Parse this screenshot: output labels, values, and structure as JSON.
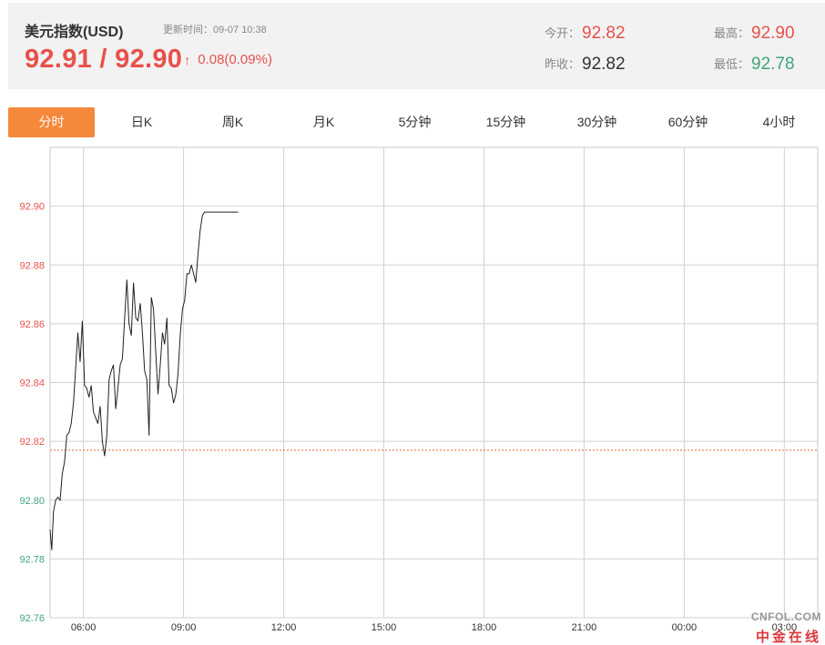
{
  "header": {
    "title": "美元指数(USD)",
    "update_label": "更新时间：",
    "update_time": "09-07 10:38",
    "price_text": "92.91 / 92.90",
    "arrow": "↑",
    "change_text": "0.08(0.09%)",
    "open_label": "今开：",
    "open_value": "92.82",
    "prev_close_label": "昨收：",
    "prev_close_value": "92.82",
    "high_label": "最高：",
    "high_value": "92.90",
    "low_label": "最低：",
    "low_value": "92.78"
  },
  "tabs": [
    {
      "label": "分时",
      "active": true
    },
    {
      "label": "日K",
      "active": false
    },
    {
      "label": "周K",
      "active": false
    },
    {
      "label": "月K",
      "active": false
    },
    {
      "label": "5分钟",
      "active": false
    },
    {
      "label": "15分钟",
      "active": false
    },
    {
      "label": "30分钟",
      "active": false
    },
    {
      "label": "60分钟",
      "active": false
    },
    {
      "label": "4小时",
      "active": false
    }
  ],
  "colors": {
    "up": "#e8514a",
    "down": "#3fa67a",
    "accent": "#f4883b",
    "line": "#222222",
    "reference": "#e07030"
  },
  "logo": {
    "top_text": "CNFOL.COM",
    "bottom_text": "中金在线"
  },
  "chart_data": {
    "type": "line",
    "title": "",
    "xlabel": "",
    "ylabel": "",
    "x_ticks": [
      "06:00",
      "09:00",
      "12:00",
      "15:00",
      "18:00",
      "21:00",
      "00:00",
      "03:00"
    ],
    "x_range": [
      "05:00",
      "04:00+1"
    ],
    "y_ticks": [
      92.9,
      92.88,
      92.86,
      92.84,
      92.82,
      92.8,
      92.78,
      92.76
    ],
    "ylim": [
      92.76,
      92.92
    ],
    "reference_value": 92.817,
    "grid": true,
    "series": [
      {
        "x": [
          "05:00",
          "05:03",
          "05:06",
          "05:10",
          "05:14",
          "05:18",
          "05:22",
          "05:26",
          "05:30",
          "05:34",
          "05:38",
          "05:42",
          "05:46",
          "05:50",
          "05:54",
          "05:58",
          "06:02",
          "06:06",
          "06:10",
          "06:14",
          "06:18",
          "06:22",
          "06:26",
          "06:30",
          "06:34",
          "06:38",
          "06:42",
          "06:46",
          "06:50",
          "06:54",
          "06:58",
          "07:02",
          "07:06",
          "07:10",
          "07:14",
          "07:18",
          "07:22",
          "07:26",
          "07:30",
          "07:34",
          "07:38",
          "07:42",
          "07:46",
          "07:50",
          "07:54",
          "07:58",
          "08:02",
          "08:06",
          "08:10",
          "08:14",
          "08:18",
          "08:22",
          "08:26",
          "08:30",
          "08:34",
          "08:38",
          "08:42",
          "08:46",
          "08:50",
          "08:54",
          "08:58",
          "09:02",
          "09:06",
          "09:10",
          "09:14",
          "09:18",
          "09:22",
          "09:26",
          "09:30",
          "09:34",
          "09:38",
          "09:42",
          "09:46",
          "09:50",
          "09:54",
          "09:58",
          "10:02",
          "10:06",
          "10:10",
          "10:14",
          "10:18",
          "10:22",
          "10:26",
          "10:30",
          "10:34",
          "10:38"
        ],
        "values": [
          92.79,
          92.783,
          92.796,
          92.8,
          92.801,
          92.8,
          92.809,
          92.813,
          92.822,
          92.823,
          92.826,
          92.833,
          92.845,
          92.857,
          92.847,
          92.861,
          92.839,
          92.838,
          92.835,
          92.839,
          92.83,
          92.828,
          92.826,
          92.832,
          92.82,
          92.815,
          92.822,
          92.841,
          92.844,
          92.846,
          92.831,
          92.838,
          92.846,
          92.848,
          92.862,
          92.875,
          92.86,
          92.856,
          92.874,
          92.862,
          92.861,
          92.867,
          92.857,
          92.844,
          92.841,
          92.822,
          92.869,
          92.865,
          92.85,
          92.836,
          92.846,
          92.857,
          92.853,
          92.862,
          92.839,
          92.838,
          92.833,
          92.836,
          92.843,
          92.856,
          92.865,
          92.868,
          92.877,
          92.877,
          92.88,
          92.877,
          92.874,
          92.884,
          92.892,
          92.897,
          92.898,
          92.898,
          92.898,
          92.898,
          92.898,
          92.898,
          92.898,
          92.898,
          92.898,
          92.898,
          92.898,
          92.898,
          92.898,
          92.898,
          92.898,
          92.898
        ]
      }
    ]
  }
}
